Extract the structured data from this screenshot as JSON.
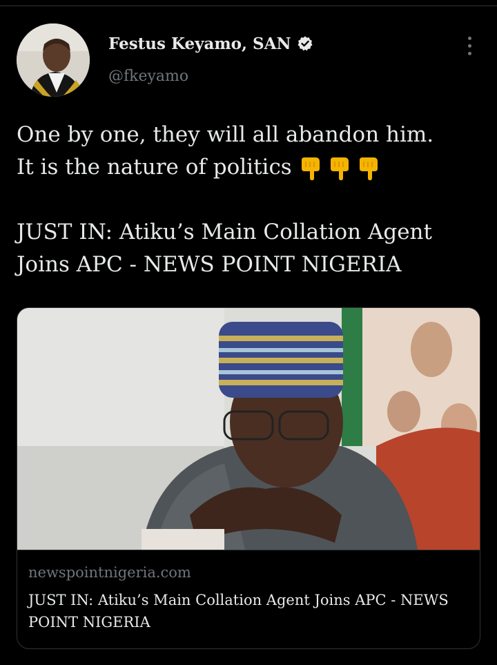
{
  "author": {
    "display_name": "Festus Keyamo, SAN",
    "handle": "@fkeyamo",
    "verified": true,
    "avatar_icon": "profile-photo-avatar"
  },
  "tweet": {
    "line1": "One by one, they will all abandon him.",
    "line2": "It is the nature of politics",
    "emoji": [
      "backhand-index-pointing-down",
      "backhand-index-pointing-down",
      "backhand-index-pointing-down"
    ],
    "headline_line1": "JUST IN: Atiku’s Main Collation Agent",
    "headline_line2": "Joins APC - NEWS POINT NIGERIA"
  },
  "card": {
    "domain": "newspointnigeria.com",
    "title": "JUST IN: Atiku’s Main Collation Agent Joins APC - NEWS POINT NIGERIA",
    "image_icon": "news-article-photo"
  },
  "colors": {
    "background": "#000000",
    "text_primary": "#e7e9ea",
    "text_secondary": "#71767b",
    "border": "#2f3336",
    "emoji": "#f5b400"
  }
}
